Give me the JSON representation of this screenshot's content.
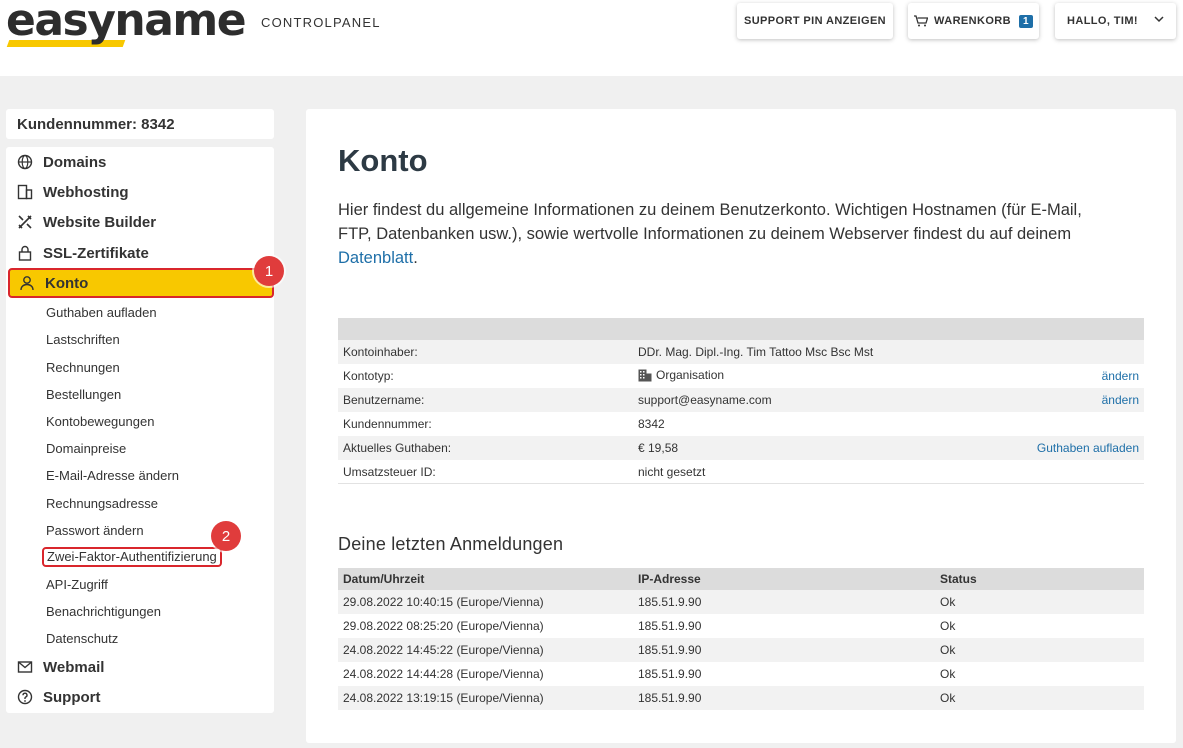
{
  "header": {
    "logo": "easyname",
    "section": "CONTROLPANEL",
    "support_pin": "SUPPORT PIN ANZEIGEN",
    "cart_label": "WARENKORB",
    "cart_count": "1",
    "user_greeting": "HALLO, TIM!"
  },
  "sidebar": {
    "customer_number": "Kundennummer: 8342",
    "main_items": [
      "Domains",
      "Webhosting",
      "Website Builder",
      "SSL-Zertifikate",
      "Konto",
      "Webmail",
      "Support"
    ],
    "sub_items": [
      "Guthaben aufladen",
      "Lastschriften",
      "Rechnungen",
      "Bestellungen",
      "Kontobewegungen",
      "Domainpreise",
      "E-Mail-Adresse ändern",
      "Rechnungsadresse",
      "Passwort ändern",
      "Zwei-Faktor-Authentifizierung",
      "API-Zugriff",
      "Benachrichtigungen",
      "Datenschutz"
    ],
    "markers": [
      "1",
      "2"
    ]
  },
  "main": {
    "title": "Konto",
    "intro": "Hier findest du allgemeine Informationen zu deinem Benutzerkonto. Wichtigen Hostnamen (für E-Mail, FTP, Datenbanken usw.), sowie wertvolle Informationen zu deinem Webserver findest du auf deinem ",
    "intro_link": "Datenblatt",
    "intro_end": ".",
    "account_rows": [
      {
        "label": "Kontoinhaber:",
        "value": "DDr. Mag. Dipl.-Ing. Tim Tattoo Msc Bsc Mst",
        "action": ""
      },
      {
        "label": "Kontotyp:",
        "value": "Organisation",
        "action": "ändern"
      },
      {
        "label": "Benutzername:",
        "value": "support@easyname.com",
        "action": "ändern"
      },
      {
        "label": "Kundennummer:",
        "value": "8342",
        "action": ""
      },
      {
        "label": "Aktuelles Guthaben:",
        "value": "€ 19,58",
        "action": "Guthaben aufladen"
      },
      {
        "label": "Umsatzsteuer ID:",
        "value": "nicht gesetzt",
        "action": ""
      }
    ],
    "logins_title": "Deine letzten Anmeldungen",
    "logins_headers": [
      "Datum/Uhrzeit",
      "IP-Adresse",
      "Status"
    ],
    "logins": [
      [
        "29.08.2022 10:40:15 (Europe/Vienna)",
        "185.51.9.90",
        "Ok"
      ],
      [
        "29.08.2022 08:25:20 (Europe/Vienna)",
        "185.51.9.90",
        "Ok"
      ],
      [
        "24.08.2022 14:45:22 (Europe/Vienna)",
        "185.51.9.90",
        "Ok"
      ],
      [
        "24.08.2022 14:44:28 (Europe/Vienna)",
        "185.51.9.90",
        "Ok"
      ],
      [
        "24.08.2022 13:19:15 (Europe/Vienna)",
        "185.51.9.90",
        "Ok"
      ]
    ]
  },
  "colors": {
    "accent": "#f8c800",
    "link": "#1e6fa8",
    "marker": "#e03c3c"
  }
}
